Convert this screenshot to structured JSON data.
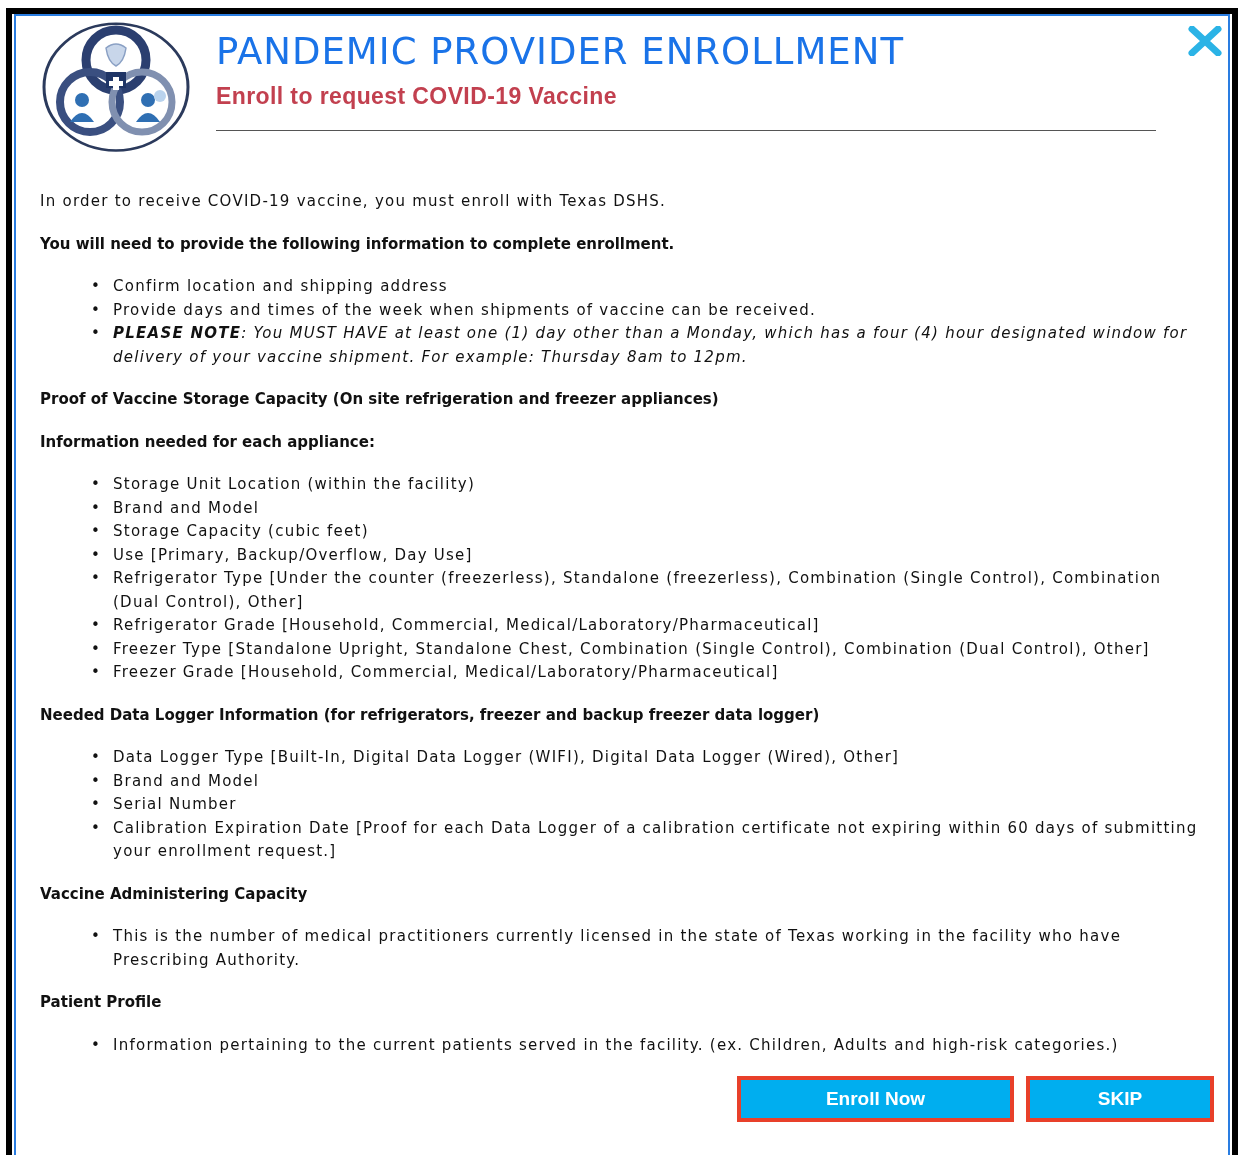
{
  "header": {
    "title": "PANDEMIC PROVIDER ENROLLMENT",
    "subtitle": "Enroll to request COVID-19 Vaccine"
  },
  "body": [
    {
      "kind": "paragraph",
      "text": "In order to receive COVID-19 vaccine, you must enroll with Texas DSHS."
    },
    {
      "kind": "heading",
      "text": "You will need to provide the following information to complete enrollment."
    },
    {
      "kind": "list",
      "marker": "•",
      "items": [
        {
          "text": "Confirm location and shipping address",
          "italic": false
        },
        {
          "text": "Provide days and times of the week when shipments of vaccine can be received.",
          "italic": false
        },
        {
          "text": "**PLEASE NOTE**: You MUST HAVE at least one (1) day other than a Monday, which has a four (4) hour designated window for delivery of your vaccine shipment. For example: Thursday 8am to 12pm.",
          "italic": true
        }
      ]
    },
    {
      "kind": "heading",
      "text": "Proof of Vaccine Storage Capacity (On site refrigeration and freezer appliances)"
    },
    {
      "kind": "heading",
      "text": "Information needed for each appliance:"
    },
    {
      "kind": "list",
      "marker": "•",
      "items": [
        {
          "text": "Storage Unit Location (within the facility)",
          "italic": false
        },
        {
          "text": "Brand and Model",
          "italic": false
        },
        {
          "text": "Storage Capacity (cubic feet)",
          "italic": false
        },
        {
          "text": "Use [Primary, Backup/Overflow, Day Use]",
          "italic": false
        },
        {
          "text": "Refrigerator Type [Under the counter (freezerless), Standalone (freezerless), Combination (Single Control), Combination (Dual Control), Other]",
          "italic": false
        },
        {
          "text": "Refrigerator Grade [Household, Commercial, Medical/Laboratory/Pharmaceutical]",
          "italic": false
        },
        {
          "text": "Freezer Type [Standalone Upright, Standalone Chest, Combination (Single Control), Combination (Dual Control), Other]",
          "italic": false
        },
        {
          "text": "Freezer Grade [Household, Commercial, Medical/Laboratory/Pharmaceutical]",
          "italic": false
        }
      ]
    },
    {
      "kind": "heading",
      "text": "Needed Data Logger Information (for refrigerators, freezer and backup freezer data logger)"
    },
    {
      "kind": "list",
      "marker": "•",
      "items": [
        {
          "text": "Data Logger Type [Built-In, Digital Data Logger (WIFI), Digital Data Logger (Wired), Other]",
          "italic": false
        },
        {
          "text": "Brand and Model",
          "italic": false
        },
        {
          "text": "Serial Number",
          "italic": false
        },
        {
          "text": "Calibration Expiration Date [Proof for each Data Logger of a calibration certificate not expiring within 60 days of submitting your enrollment request.]",
          "italic": false
        }
      ]
    },
    {
      "kind": "heading",
      "text": "Vaccine Administering Capacity"
    },
    {
      "kind": "list",
      "marker": "•",
      "items": [
        {
          "text": "This is the number of medical practitioners currently licensed in the state of Texas working in the facility who have Prescribing Authority.",
          "italic": false
        }
      ]
    },
    {
      "kind": "heading",
      "text": "Patient Profile"
    },
    {
      "kind": "list",
      "marker": "•",
      "items": [
        {
          "text": "Information pertaining to the current patients served in the facility. (ex. Children, Adults and high-risk categories.)",
          "italic": false
        }
      ]
    }
  ],
  "buttons": [
    "Enroll Now",
    "SKIP"
  ]
}
